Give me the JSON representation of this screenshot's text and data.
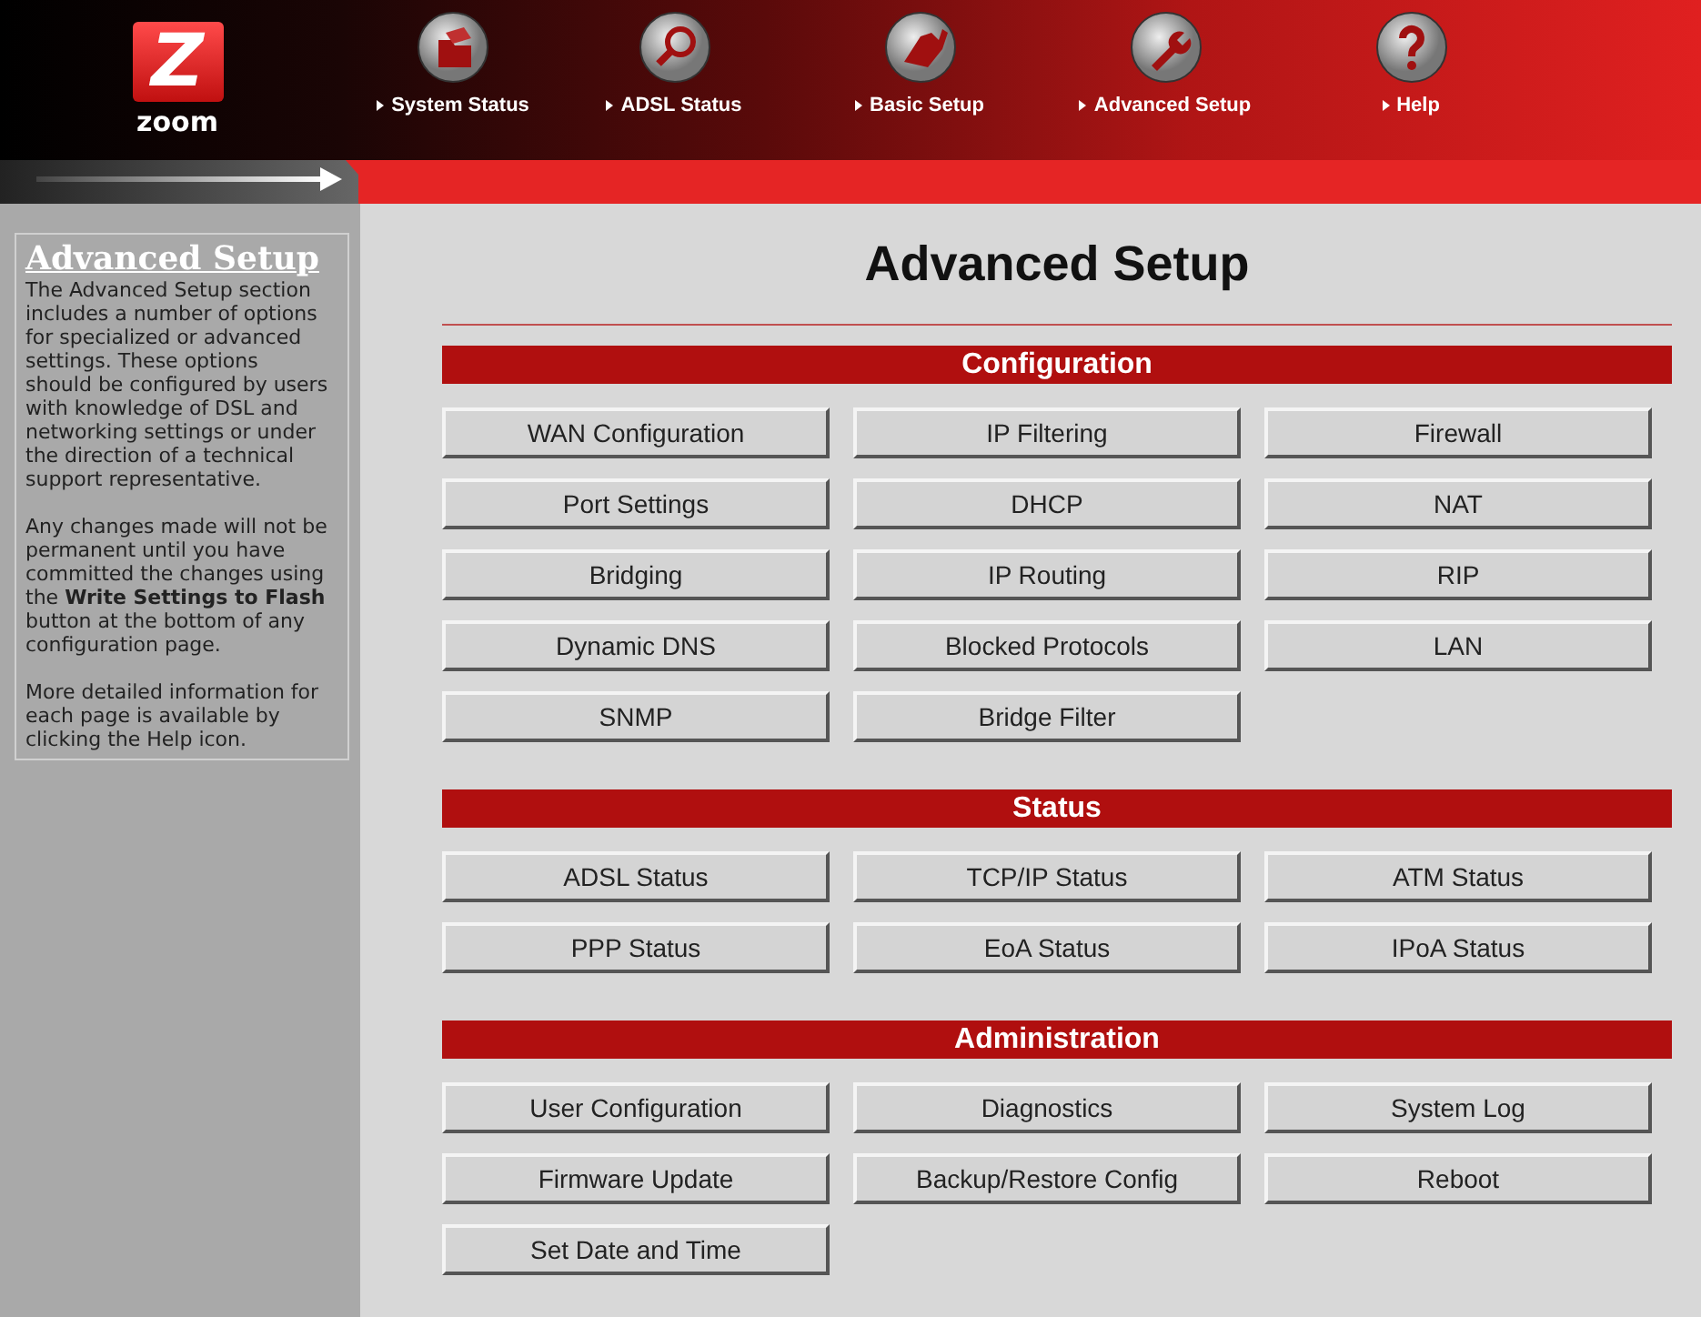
{
  "logo": {
    "mark": "Z",
    "name": "zoom"
  },
  "nav": [
    {
      "label": "System Status",
      "kind": "folder"
    },
    {
      "label": "ADSL Status",
      "kind": "search"
    },
    {
      "label": "Basic Setup",
      "kind": "hand"
    },
    {
      "label": "Advanced Setup",
      "kind": "wrench"
    },
    {
      "label": "Help",
      "kind": "help"
    }
  ],
  "sidebar": {
    "title": "Advanced Setup",
    "paragraphs": [
      "The Advanced Setup section includes a number of options for specialized or advanced settings. These options should be configured by users with knowledge of DSL and networking settings or under the direction of a technical support representative.",
      "Any changes made will not be permanent until you have committed the changes using the **Write Settings to Flash** button at the bottom of any configuration page.",
      "More detailed information for each page is available by clicking the Help icon."
    ]
  },
  "page_title": "Advanced Setup",
  "sections": [
    {
      "title": "Configuration",
      "buttons": [
        "WAN Configuration",
        "IP Filtering",
        "Firewall",
        "Port Settings",
        "DHCP",
        "NAT",
        "Bridging",
        "IP Routing",
        "RIP",
        "Dynamic DNS",
        "Blocked Protocols",
        "LAN",
        "SNMP",
        "Bridge Filter"
      ]
    },
    {
      "title": "Status",
      "buttons": [
        "ADSL Status",
        "TCP/IP Status",
        "ATM Status",
        "PPP Status",
        "EoA Status",
        "IPoA Status"
      ]
    },
    {
      "title": "Administration",
      "buttons": [
        "User Configuration",
        "Diagnostics",
        "System Log",
        "Firmware Update",
        "Backup/Restore Config",
        "Reboot",
        "Set Date and Time"
      ]
    }
  ]
}
